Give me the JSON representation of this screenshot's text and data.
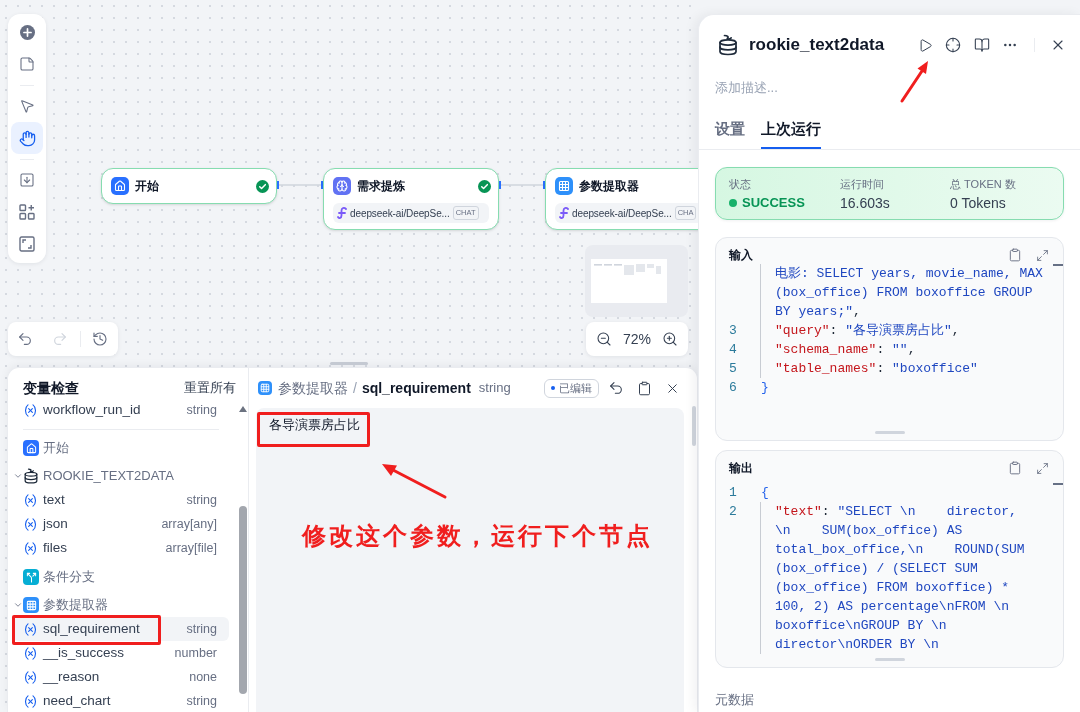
{
  "canvas": {
    "toolbar": {
      "groups": [
        {
          "tools": [
            {
              "kind": "add",
              "selected": false
            },
            {
              "kind": "note",
              "selected": false
            }
          ]
        },
        {
          "tools": [
            {
              "kind": "pointer",
              "selected": false
            },
            {
              "kind": "hand",
              "selected": true
            }
          ]
        },
        {
          "tools": [
            {
              "kind": "export",
              "selected": false
            },
            {
              "kind": "organize",
              "selected": false
            },
            {
              "kind": "fit",
              "selected": false
            }
          ]
        }
      ]
    },
    "nodes": [
      {
        "kind": "start",
        "title": "开始",
        "done": true
      },
      {
        "kind": "llm",
        "title": "需求提炼",
        "done": true,
        "model": "deepseek-ai/DeepSe...",
        "mode": "CHAT"
      },
      {
        "kind": "extractor",
        "title": "参数提取器",
        "model": "deepseek-ai/DeepSe...",
        "mode": "CHA"
      }
    ],
    "zoom": "72%",
    "history": {
      "undo": {
        "disabled": false
      },
      "redo": {
        "disabled": true
      }
    }
  },
  "inspector": {
    "title": "变量检查",
    "reset": "重置所有",
    "groups": [
      {
        "kind": "system",
        "variables": [
          {
            "name": "workflow_run_id",
            "type": "string",
            "selected": false
          }
        ]
      },
      {
        "kind": "start",
        "title": "开始"
      },
      {
        "kind": "agent",
        "title": "ROOKIE_TEXT2DATA",
        "expanded": true,
        "variables": [
          {
            "name": "text",
            "type": "string",
            "selected": false
          },
          {
            "name": "json",
            "type": "array[any]",
            "selected": false
          },
          {
            "name": "files",
            "type": "array[file]",
            "selected": false
          }
        ]
      },
      {
        "kind": "branch",
        "title": "条件分支"
      },
      {
        "kind": "extractor",
        "title": "参数提取器",
        "expanded": true,
        "variables": [
          {
            "name": "sql_requirement",
            "type": "string",
            "selected": true
          },
          {
            "name": "__is_success",
            "type": "number",
            "selected": false
          },
          {
            "name": "__reason",
            "type": "none",
            "selected": false
          },
          {
            "name": "need_chart",
            "type": "string",
            "selected": false
          }
        ]
      }
    ]
  },
  "editor": {
    "kind": "extractor",
    "node": "参数提取器",
    "separator": "/",
    "variable": "sql_requirement",
    "type": "string",
    "edited_tag": "已编辑",
    "value": "各导演票房占比"
  },
  "annotation": {
    "note": "修改这个参数，运行下个节点"
  },
  "panel": {
    "title": "rookie_text2data",
    "description_placeholder": "添加描述...",
    "tabs": [
      {
        "label": "设置",
        "selected": false
      },
      {
        "label": "上次运行",
        "selected": true
      }
    ],
    "status": [
      {
        "kind": "status",
        "label": "状态",
        "value": "SUCCESS"
      },
      {
        "kind": "text",
        "label": "运行时间",
        "value": "16.603s"
      },
      {
        "kind": "text",
        "label": "总 TOKEN 数",
        "value": "0 Tokens"
      }
    ],
    "input": {
      "title": "输入",
      "lines": [
        {
          "guide": true,
          "tokens": [
            {
              "kind": "string",
              "text": "电影: SELECT years, movie_name, MAX"
            }
          ]
        },
        {
          "guide": true,
          "tokens": [
            {
              "kind": "string",
              "text": "(box_office) FROM boxoffice GROUP"
            }
          ]
        },
        {
          "guide": true,
          "tokens": [
            {
              "kind": "string",
              "text": "BY years;\""
            },
            {
              "kind": "punct",
              "text": ","
            }
          ]
        },
        {
          "number": "3",
          "guide": true,
          "tokens": [
            {
              "kind": "key",
              "text": "\"query\""
            },
            {
              "kind": "punct",
              "text": ": "
            },
            {
              "kind": "string",
              "text": "\"各导演票房占比\""
            },
            {
              "kind": "punct",
              "text": ","
            }
          ]
        },
        {
          "number": "4",
          "guide": true,
          "tokens": [
            {
              "kind": "key",
              "text": "\"schema_name\""
            },
            {
              "kind": "punct",
              "text": ": "
            },
            {
              "kind": "string",
              "text": "\"\""
            },
            {
              "kind": "punct",
              "text": ","
            }
          ]
        },
        {
          "number": "5",
          "guide": true,
          "tokens": [
            {
              "kind": "key",
              "text": "\"table_names\""
            },
            {
              "kind": "punct",
              "text": ": "
            },
            {
              "kind": "string",
              "text": "\"boxoffice\""
            }
          ]
        },
        {
          "number": "6",
          "guide": false,
          "tokens": [
            {
              "kind": "brace",
              "text": "}"
            }
          ]
        }
      ]
    },
    "output": {
      "title": "输出",
      "lines": [
        {
          "number": "1",
          "guide": false,
          "tokens": [
            {
              "kind": "brace",
              "text": "{"
            }
          ]
        },
        {
          "number": "2",
          "guide": true,
          "tokens": [
            {
              "kind": "key",
              "text": "\"text\""
            },
            {
              "kind": "punct",
              "text": ": "
            },
            {
              "kind": "string",
              "text": "\"SELECT \\n    director,"
            }
          ]
        },
        {
          "guide": true,
          "tokens": [
            {
              "kind": "string",
              "text": "\\n    SUM(box_office) AS"
            }
          ]
        },
        {
          "guide": true,
          "tokens": [
            {
              "kind": "string",
              "text": "total_box_office,\\n    ROUND(SUM"
            }
          ]
        },
        {
          "guide": true,
          "tokens": [
            {
              "kind": "string",
              "text": "(box_office) / (SELECT SUM"
            }
          ]
        },
        {
          "guide": true,
          "tokens": [
            {
              "kind": "string",
              "text": "(box_office) FROM boxoffice) *"
            }
          ]
        },
        {
          "guide": true,
          "tokens": [
            {
              "kind": "string",
              "text": "100, 2) AS percentage\\nFROM \\n"
            }
          ]
        },
        {
          "guide": true,
          "tokens": [
            {
              "kind": "string",
              "text": "boxoffice\\nGROUP BY \\n"
            }
          ]
        },
        {
          "guide": true,
          "tokens": [
            {
              "kind": "string",
              "text": "director\\nORDER BY \\n"
            }
          ]
        }
      ]
    },
    "metadata": "元数据"
  }
}
